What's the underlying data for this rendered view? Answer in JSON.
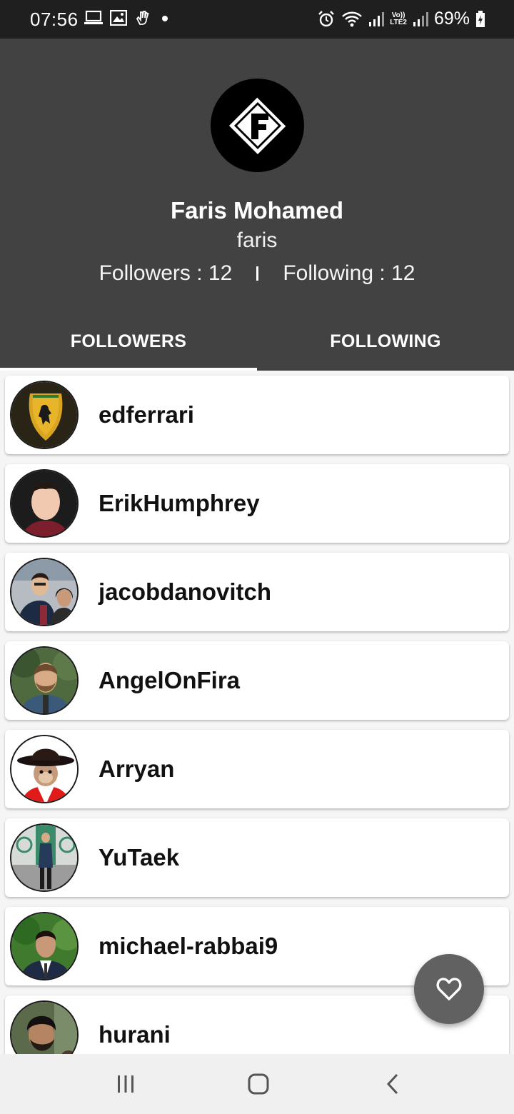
{
  "status_bar": {
    "time": "07:56",
    "battery_percent": "69%",
    "left_icons": [
      "laptop-icon",
      "image-icon",
      "gesture-icon",
      "dot-icon"
    ],
    "right_icons": [
      "alarm-icon",
      "wifi-icon",
      "signal-icon",
      "signal-icon",
      "battery-icon"
    ],
    "lte_label_top": "Vo))",
    "lte_label_bottom": "LTE2"
  },
  "profile": {
    "name": "Faris Mohamed",
    "username": "faris",
    "followers_text": "Followers : 12",
    "following_text": "Following : 12",
    "avatar_icon": "f-logo-icon"
  },
  "tabs": [
    {
      "label": "FOLLOWERS",
      "active": true
    },
    {
      "label": "FOLLOWING",
      "active": false
    }
  ],
  "followers": [
    {
      "username": "edferrari",
      "avatar": "ferrari-badge-avatar"
    },
    {
      "username": "ErikHumphrey",
      "avatar": "person-avatar"
    },
    {
      "username": "jacobdanovitch",
      "avatar": "couple-avatar"
    },
    {
      "username": "AngelOnFira",
      "avatar": "person-avatar"
    },
    {
      "username": "Arryan",
      "avatar": "monkey-avatar"
    },
    {
      "username": "YuTaek",
      "avatar": "person-avatar"
    },
    {
      "username": "michael-rabbai9",
      "avatar": "person-avatar"
    },
    {
      "username": "hurani",
      "avatar": "person-avatar"
    }
  ],
  "fab": {
    "icon": "heart-icon"
  },
  "nav_bar": {
    "icons": [
      "recent-apps-icon",
      "home-icon",
      "back-icon"
    ]
  },
  "colors": {
    "header_bg": "#424242",
    "status_bar_bg": "#1f1f1f",
    "fab_bg": "#616161",
    "list_bg": "#f5f5f5"
  }
}
